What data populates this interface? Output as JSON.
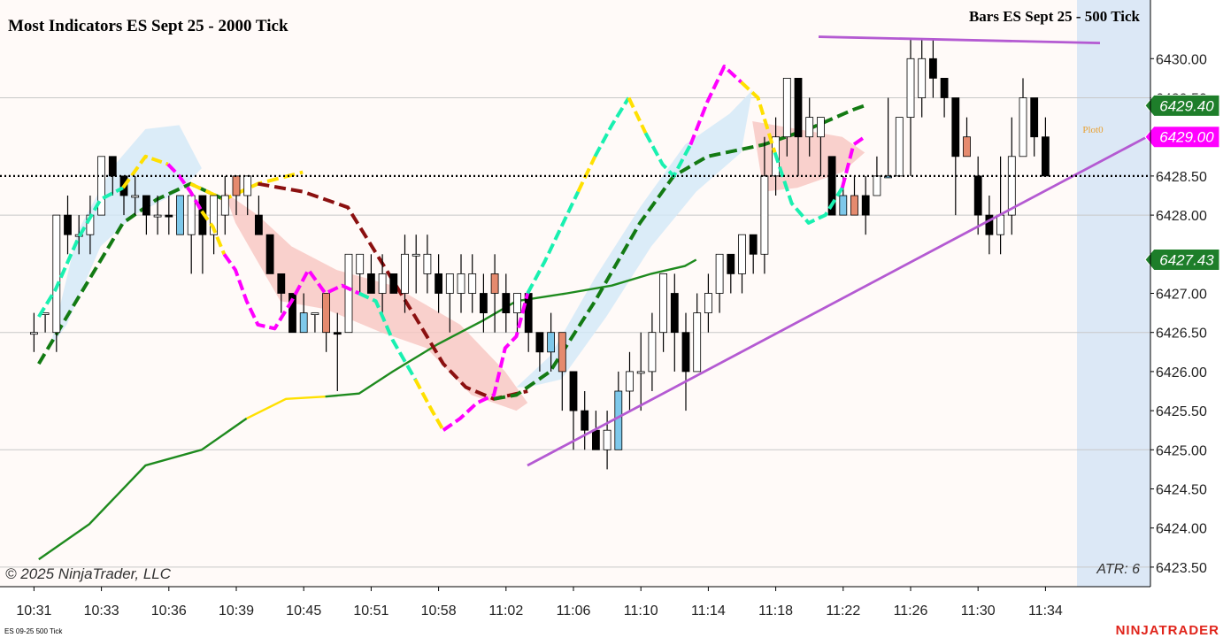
{
  "title": "Most Indicators ES Sept 25 - 2000 Tick",
  "subtitle": "Bars ES Sept 25 - 500 Tick",
  "copyright": "© 2025 NinjaTrader, LLC",
  "instrument_note": "ES 09-25 500 Tick",
  "brand": "NINJATRADER",
  "atr_label": "ATR: 6",
  "plot_label": "Plot0",
  "price_tags": [
    {
      "label": "6429.40",
      "value": 6429.4,
      "bg": "#1e7e2a",
      "fg": "#ffffff"
    },
    {
      "label": "6429.00",
      "value": 6429.0,
      "bg": "#ff00ff",
      "fg": "#ffffff"
    },
    {
      "label": "6427.43",
      "value": 6427.43,
      "bg": "#1e7e2a",
      "fg": "#ffffff"
    }
  ],
  "colors": {
    "background": "#fffaf8",
    "bull_body": "#ffffff",
    "bear_body": "#000000",
    "neutral_blue": "#7ec8ea",
    "neutral_salmon": "#e58a6e",
    "cyan_dash": "#19f0b0",
    "magenta_dash": "#ff00ff",
    "yellow_dash": "#ffe000",
    "dark_red_dash": "#8b1010",
    "green_dash": "#137a13",
    "solid_green": "#1e8a1e",
    "trend_line": "#b45ad2",
    "dotted_line": "#000000",
    "cloud_blue": "#d2e8f8",
    "cloud_red": "#f8c6c0",
    "right_band": "#dce8f6",
    "brand": "#e0231a"
  },
  "chart_data": {
    "type": "candlestick",
    "title": "Most Indicators ES Sept 25 - 2000 Tick",
    "ylim": [
      6423.25,
      6430.75
    ],
    "grid": true,
    "y_ticks": [
      {
        "label": "6430.00",
        "value": 6430.0
      },
      {
        "label": "6429.50",
        "value": 6429.5
      },
      {
        "label": "6429.00",
        "value": 6429.0
      },
      {
        "label": "6428.50",
        "value": 6428.5
      },
      {
        "label": "6428.00",
        "value": 6428.0
      },
      {
        "label": "6427.50",
        "value": 6427.5
      },
      {
        "label": "6427.00",
        "value": 6427.0
      },
      {
        "label": "6426.50",
        "value": 6426.5
      },
      {
        "label": "6426.00",
        "value": 6426.0
      },
      {
        "label": "6425.50",
        "value": 6425.5
      },
      {
        "label": "6425.00",
        "value": 6425.0
      },
      {
        "label": "6424.50",
        "value": 6424.5
      },
      {
        "label": "6424.00",
        "value": 6424.0
      },
      {
        "label": "6423.50",
        "value": 6423.5
      }
    ],
    "hidden_tick_values": [
      6429.0,
      6427.5
    ],
    "x_ticks": [
      {
        "label": "10:31",
        "bar": 0
      },
      {
        "label": "10:33",
        "bar": 6
      },
      {
        "label": "10:36",
        "bar": 12
      },
      {
        "label": "10:39",
        "bar": 18
      },
      {
        "label": "10:45",
        "bar": 24
      },
      {
        "label": "10:51",
        "bar": 30
      },
      {
        "label": "10:58",
        "bar": 36
      },
      {
        "label": "11:02",
        "bar": 42
      },
      {
        "label": "11:06",
        "bar": 48
      },
      {
        "label": "11:10",
        "bar": 54
      },
      {
        "label": "11:14",
        "bar": 60
      },
      {
        "label": "11:18",
        "bar": 66
      },
      {
        "label": "11:22",
        "bar": 72
      },
      {
        "label": "11:26",
        "bar": 78
      },
      {
        "label": "11:30",
        "bar": 84
      },
      {
        "label": "11:34",
        "bar": 90
      }
    ],
    "bar_count": 91,
    "candles": [
      [
        6426.5,
        6426.5,
        6426.25,
        6426.75,
        "w"
      ],
      [
        6426.75,
        6426.75,
        6426.5,
        6426.75,
        "w"
      ],
      [
        6426.5,
        6428.0,
        6426.25,
        6428.0,
        "w"
      ],
      [
        6428.0,
        6427.75,
        6427.5,
        6428.25,
        "k"
      ],
      [
        6427.75,
        6427.75,
        6427.5,
        6428.0,
        "w"
      ],
      [
        6427.75,
        6428.0,
        6427.5,
        6428.25,
        "w"
      ],
      [
        6428.0,
        6428.75,
        6428.0,
        6428.75,
        "w"
      ],
      [
        6428.75,
        6428.5,
        6428.25,
        6428.75,
        "k"
      ],
      [
        6428.5,
        6428.25,
        6428.0,
        6428.5,
        "k"
      ],
      [
        6428.25,
        6428.25,
        6428.0,
        6428.5,
        "w"
      ],
      [
        6428.25,
        6428.0,
        6427.75,
        6428.25,
        "k"
      ],
      [
        6428.0,
        6428.0,
        6427.75,
        6428.25,
        "w"
      ],
      [
        6428.0,
        6428.0,
        6427.75,
        6428.25,
        "k"
      ],
      [
        6428.25,
        6427.75,
        6427.75,
        6428.25,
        "b"
      ],
      [
        6427.75,
        6428.25,
        6427.25,
        6428.25,
        "w"
      ],
      [
        6428.25,
        6427.75,
        6427.25,
        6428.25,
        "k"
      ],
      [
        6427.75,
        6428.25,
        6427.5,
        6428.25,
        "w"
      ],
      [
        6428.25,
        6428.0,
        6427.75,
        6428.5,
        "w"
      ],
      [
        6428.5,
        6428.25,
        6428.0,
        6428.5,
        "s"
      ],
      [
        6428.25,
        6428.5,
        6428.0,
        6428.5,
        "w"
      ],
      [
        6428.0,
        6427.75,
        6427.75,
        6428.25,
        "k"
      ],
      [
        6427.75,
        6427.25,
        6427.25,
        6427.75,
        "k"
      ],
      [
        6427.25,
        6427.0,
        6426.75,
        6427.25,
        "k"
      ],
      [
        6427.0,
        6426.5,
        6426.5,
        6427.0,
        "k"
      ],
      [
        6426.75,
        6426.5,
        6426.5,
        6427.0,
        "b"
      ],
      [
        6426.75,
        6426.75,
        6426.5,
        6426.75,
        "w"
      ],
      [
        6427.0,
        6426.5,
        6426.25,
        6427.0,
        "s"
      ],
      [
        6426.5,
        6426.5,
        6425.75,
        6426.75,
        "k"
      ],
      [
        6426.5,
        6427.5,
        6426.5,
        6427.5,
        "w"
      ],
      [
        6427.5,
        6427.25,
        6427.0,
        6427.5,
        "w"
      ],
      [
        6427.25,
        6427.0,
        6427.0,
        6427.5,
        "k"
      ],
      [
        6427.0,
        6427.25,
        6426.75,
        6427.5,
        "w"
      ],
      [
        6427.25,
        6427.0,
        6427.0,
        6427.25,
        "k"
      ],
      [
        6427.0,
        6427.5,
        6426.75,
        6427.75,
        "w"
      ],
      [
        6427.5,
        6427.5,
        6427.0,
        6427.75,
        "w"
      ],
      [
        6427.5,
        6427.25,
        6427.0,
        6427.75,
        "w"
      ],
      [
        6427.25,
        6427.0,
        6426.75,
        6427.5,
        "k"
      ],
      [
        6427.25,
        6427.0,
        6426.5,
        6427.25,
        "w"
      ],
      [
        6427.0,
        6427.25,
        6426.75,
        6427.5,
        "w"
      ],
      [
        6427.25,
        6427.0,
        6426.75,
        6427.5,
        "w"
      ],
      [
        6427.0,
        6426.75,
        6426.5,
        6427.25,
        "k"
      ],
      [
        6427.25,
        6427.0,
        6426.5,
        6427.5,
        "s"
      ],
      [
        6427.0,
        6426.75,
        6426.5,
        6427.25,
        "k"
      ],
      [
        6427.0,
        6426.75,
        6426.5,
        6427.0,
        "w"
      ],
      [
        6427.0,
        6426.5,
        6426.25,
        6427.0,
        "k"
      ],
      [
        6426.5,
        6426.25,
        6426.0,
        6426.5,
        "k"
      ],
      [
        6426.5,
        6426.25,
        6426.0,
        6426.75,
        "b"
      ],
      [
        6426.5,
        6426.0,
        6425.5,
        6426.5,
        "s"
      ],
      [
        6426.0,
        6425.5,
        6425.0,
        6426.0,
        "k"
      ],
      [
        6425.5,
        6425.25,
        6425.0,
        6425.75,
        "k"
      ],
      [
        6425.25,
        6425.0,
        6425.0,
        6425.5,
        "k"
      ],
      [
        6425.25,
        6425.0,
        6424.75,
        6425.5,
        "w"
      ],
      [
        6425.0,
        6425.75,
        6425.0,
        6426.0,
        "b"
      ],
      [
        6425.75,
        6426.0,
        6425.5,
        6426.25,
        "w"
      ],
      [
        6426.0,
        6426.0,
        6425.5,
        6426.5,
        "w"
      ],
      [
        6426.0,
        6426.5,
        6425.75,
        6426.75,
        "w"
      ],
      [
        6426.5,
        6427.25,
        6426.25,
        6427.25,
        "w"
      ],
      [
        6427.0,
        6426.5,
        6426.0,
        6427.25,
        "k"
      ],
      [
        6426.5,
        6426.0,
        6425.5,
        6426.75,
        "k"
      ],
      [
        6426.0,
        6426.75,
        6426.0,
        6427.0,
        "w"
      ],
      [
        6426.75,
        6427.0,
        6426.5,
        6427.25,
        "w"
      ],
      [
        6427.0,
        6427.5,
        6426.75,
        6427.5,
        "w"
      ],
      [
        6427.5,
        6427.25,
        6427.0,
        6427.5,
        "k"
      ],
      [
        6427.25,
        6427.75,
        6427.0,
        6427.75,
        "w"
      ],
      [
        6427.75,
        6427.5,
        6427.25,
        6427.75,
        "k"
      ],
      [
        6427.5,
        6428.5,
        6427.25,
        6429.0,
        "w"
      ],
      [
        6428.5,
        6429.0,
        6428.25,
        6429.25,
        "w"
      ],
      [
        6429.0,
        6429.75,
        6428.75,
        6429.75,
        "w"
      ],
      [
        6429.75,
        6429.0,
        6428.5,
        6429.75,
        "k"
      ],
      [
        6429.0,
        6429.25,
        6428.75,
        6429.5,
        "w"
      ],
      [
        6429.25,
        6429.0,
        6428.5,
        6429.25,
        "w"
      ],
      [
        6428.75,
        6428.0,
        6428.0,
        6428.75,
        "k"
      ],
      [
        6428.25,
        6428.0,
        6428.0,
        6428.5,
        "b"
      ],
      [
        6428.0,
        6428.25,
        6428.0,
        6428.5,
        "s"
      ],
      [
        6428.25,
        6428.0,
        6427.75,
        6428.5,
        "k"
      ],
      [
        6428.25,
        6428.5,
        6428.25,
        6428.75,
        "w"
      ],
      [
        6428.5,
        6428.5,
        6428.5,
        6429.5,
        "b"
      ],
      [
        6428.5,
        6429.25,
        6428.5,
        6429.25,
        "w"
      ],
      [
        6429.25,
        6430.0,
        6428.5,
        6430.25,
        "w"
      ],
      [
        6430.0,
        6429.5,
        6429.25,
        6430.25,
        "w"
      ],
      [
        6430.0,
        6429.75,
        6429.5,
        6430.25,
        "k"
      ],
      [
        6429.75,
        6429.5,
        6429.25,
        6429.75,
        "k"
      ],
      [
        6429.5,
        6428.75,
        6428.0,
        6429.5,
        "k"
      ],
      [
        6428.75,
        6429.0,
        6428.75,
        6429.25,
        "s"
      ],
      [
        6428.5,
        6428.0,
        6427.75,
        6428.75,
        "k"
      ],
      [
        6428.0,
        6427.75,
        6427.5,
        6428.25,
        "k"
      ],
      [
        6427.75,
        6428.0,
        6427.5,
        6428.75,
        "w"
      ],
      [
        6428.0,
        6428.75,
        6427.75,
        6429.25,
        "w"
      ],
      [
        6428.75,
        6429.5,
        6428.75,
        6429.75,
        "w"
      ],
      [
        6429.5,
        6429.0,
        6428.75,
        6429.5,
        "k"
      ],
      [
        6429.0,
        6428.5,
        6428.5,
        6429.25,
        "k"
      ]
    ],
    "lines": {
      "green_solid_ma": [
        [
          1,
          6423.6
        ],
        [
          10,
          6424.05
        ],
        [
          20,
          6424.8
        ],
        [
          30,
          6425.0
        ],
        [
          38,
          6425.4
        ],
        [
          45,
          6425.65
        ],
        [
          52,
          6425.68
        ],
        [
          58,
          6425.72
        ],
        [
          64,
          6426.0
        ],
        [
          72,
          6426.35
        ],
        [
          80,
          6426.65
        ],
        [
          86,
          6426.9
        ],
        [
          95,
          6427.0
        ],
        [
          103,
          6427.1
        ],
        [
          110,
          6427.25
        ],
        [
          116,
          6427.35
        ],
        [
          118,
          6427.43
        ]
      ],
      "green_dash_ma": [
        [
          1,
          6426.1
        ],
        [
          6,
          6426.7
        ],
        [
          11,
          6427.3
        ],
        [
          16,
          6427.9
        ],
        [
          22,
          6428.2
        ],
        [
          28,
          6428.4
        ],
        [
          34,
          6428.2
        ],
        [
          40,
          6428.4
        ],
        [
          48,
          6428.55
        ]
      ],
      "darkred_dash_ma": [
        [
          40,
          6428.4
        ],
        [
          48,
          6428.3
        ],
        [
          56,
          6428.1
        ],
        [
          62,
          6427.4
        ],
        [
          68,
          6426.7
        ],
        [
          73,
          6426.1
        ],
        [
          77,
          6425.8
        ],
        [
          82,
          6425.65
        ],
        [
          88,
          6425.75
        ],
        [
          94,
          6426.05
        ],
        [
          100,
          6426.5
        ],
        [
          104,
          6426.9
        ],
        [
          108,
          6427.3
        ],
        [
          112,
          6427.7
        ],
        [
          118,
          6428.05
        ],
        [
          125,
          6428.45
        ]
      ],
      "fast_cycle": [
        [
          1,
          6426.7
        ],
        [
          4,
          6427.05
        ],
        [
          8,
          6427.7
        ],
        [
          12,
          6428.2
        ],
        [
          16,
          6428.35
        ],
        [
          20,
          6428.75
        ],
        [
          24,
          6428.65
        ],
        [
          26,
          6428.5
        ],
        [
          28,
          6428.3
        ],
        [
          30,
          6428.05
        ],
        [
          32,
          6427.85
        ],
        [
          34,
          6427.5
        ],
        [
          36,
          6427.3
        ],
        [
          38,
          6426.9
        ],
        [
          40,
          6426.6
        ],
        [
          43,
          6426.55
        ],
        [
          46,
          6426.9
        ],
        [
          49,
          6427.3
        ],
        [
          52,
          6427.0
        ],
        [
          55,
          6427.1
        ],
        [
          58,
          6427.0
        ],
        [
          61,
          6426.9
        ],
        [
          64,
          6426.4
        ],
        [
          68,
          6425.9
        ],
        [
          71,
          6425.5
        ],
        [
          73,
          6425.25
        ],
        [
          76,
          6425.4
        ],
        [
          79,
          6425.6
        ],
        [
          82,
          6425.7
        ],
        [
          84,
          6426.3
        ],
        [
          86,
          6426.45
        ],
        [
          88,
          6427.0
        ],
        [
          91,
          6427.4
        ],
        [
          94,
          6427.85
        ],
        [
          97,
          6428.3
        ],
        [
          100,
          6428.75
        ],
        [
          103,
          6429.15
        ],
        [
          106,
          6429.5
        ],
        [
          109,
          6429.05
        ],
        [
          112,
          6428.65
        ],
        [
          114,
          6428.5
        ],
        [
          117,
          6428.9
        ],
        [
          120,
          6429.45
        ],
        [
          123,
          6429.9
        ],
        [
          126,
          6429.7
        ],
        [
          129,
          6429.5
        ],
        [
          132,
          6428.8
        ],
        [
          135,
          6428.15
        ],
        [
          138,
          6427.9
        ],
        [
          141,
          6428.0
        ],
        [
          144,
          6428.35
        ],
        [
          146,
          6428.9
        ],
        [
          148,
          6429.0
        ]
      ]
    }
  }
}
